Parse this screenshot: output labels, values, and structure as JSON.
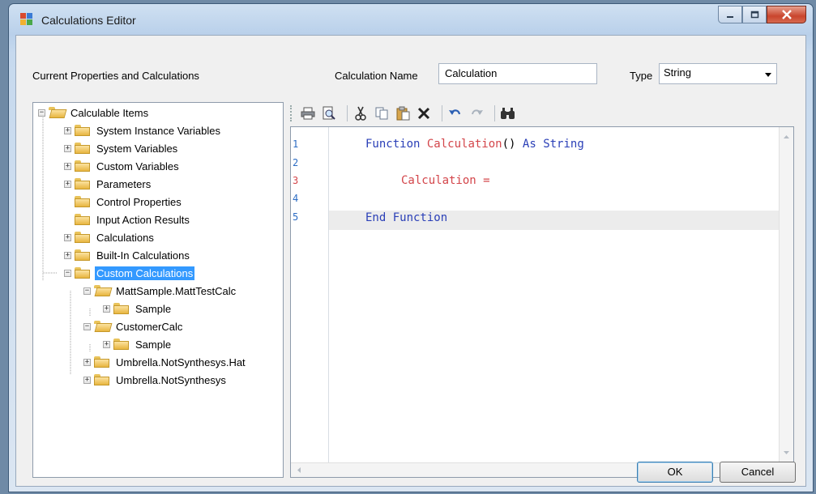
{
  "window": {
    "title": "Calculations Editor"
  },
  "header": {
    "tree_label": "Current Properties and Calculations",
    "calc_name_label": "Calculation Name",
    "calc_name_value": "Calculation",
    "type_label": "Type",
    "type_value": "String"
  },
  "tree": {
    "root": "Calculable Items",
    "items": [
      "System Instance Variables",
      "System Variables",
      "Custom Variables",
      "Parameters",
      "Control Properties",
      "Input Action Results",
      "Calculations",
      "Built-In Calculations",
      "Custom Calculations",
      "MattSample.MattTestCalc",
      "Sample",
      "CustomerCalc",
      "Sample",
      "Umbrella.NotSynthesys.Hat",
      "Umbrella.NotSynthesys"
    ],
    "selected": "Custom Calculations"
  },
  "toolbar": {
    "icons": [
      "print-icon",
      "print-preview-icon",
      "cut-icon",
      "copy-icon",
      "paste-icon",
      "delete-icon",
      "undo-icon",
      "redo-icon",
      "find-icon"
    ]
  },
  "editor": {
    "line_numbers": [
      "1",
      "2",
      "3",
      "4",
      "5"
    ],
    "line1": {
      "kw1": "Function",
      "name": "Calculation",
      "parens": "()",
      "kw2": "As",
      "kw3": "String"
    },
    "line3": {
      "name": "Calculation",
      "op": "="
    },
    "line5": {
      "kw": "End Function"
    }
  },
  "buttons": {
    "ok": "OK",
    "cancel": "Cancel"
  }
}
